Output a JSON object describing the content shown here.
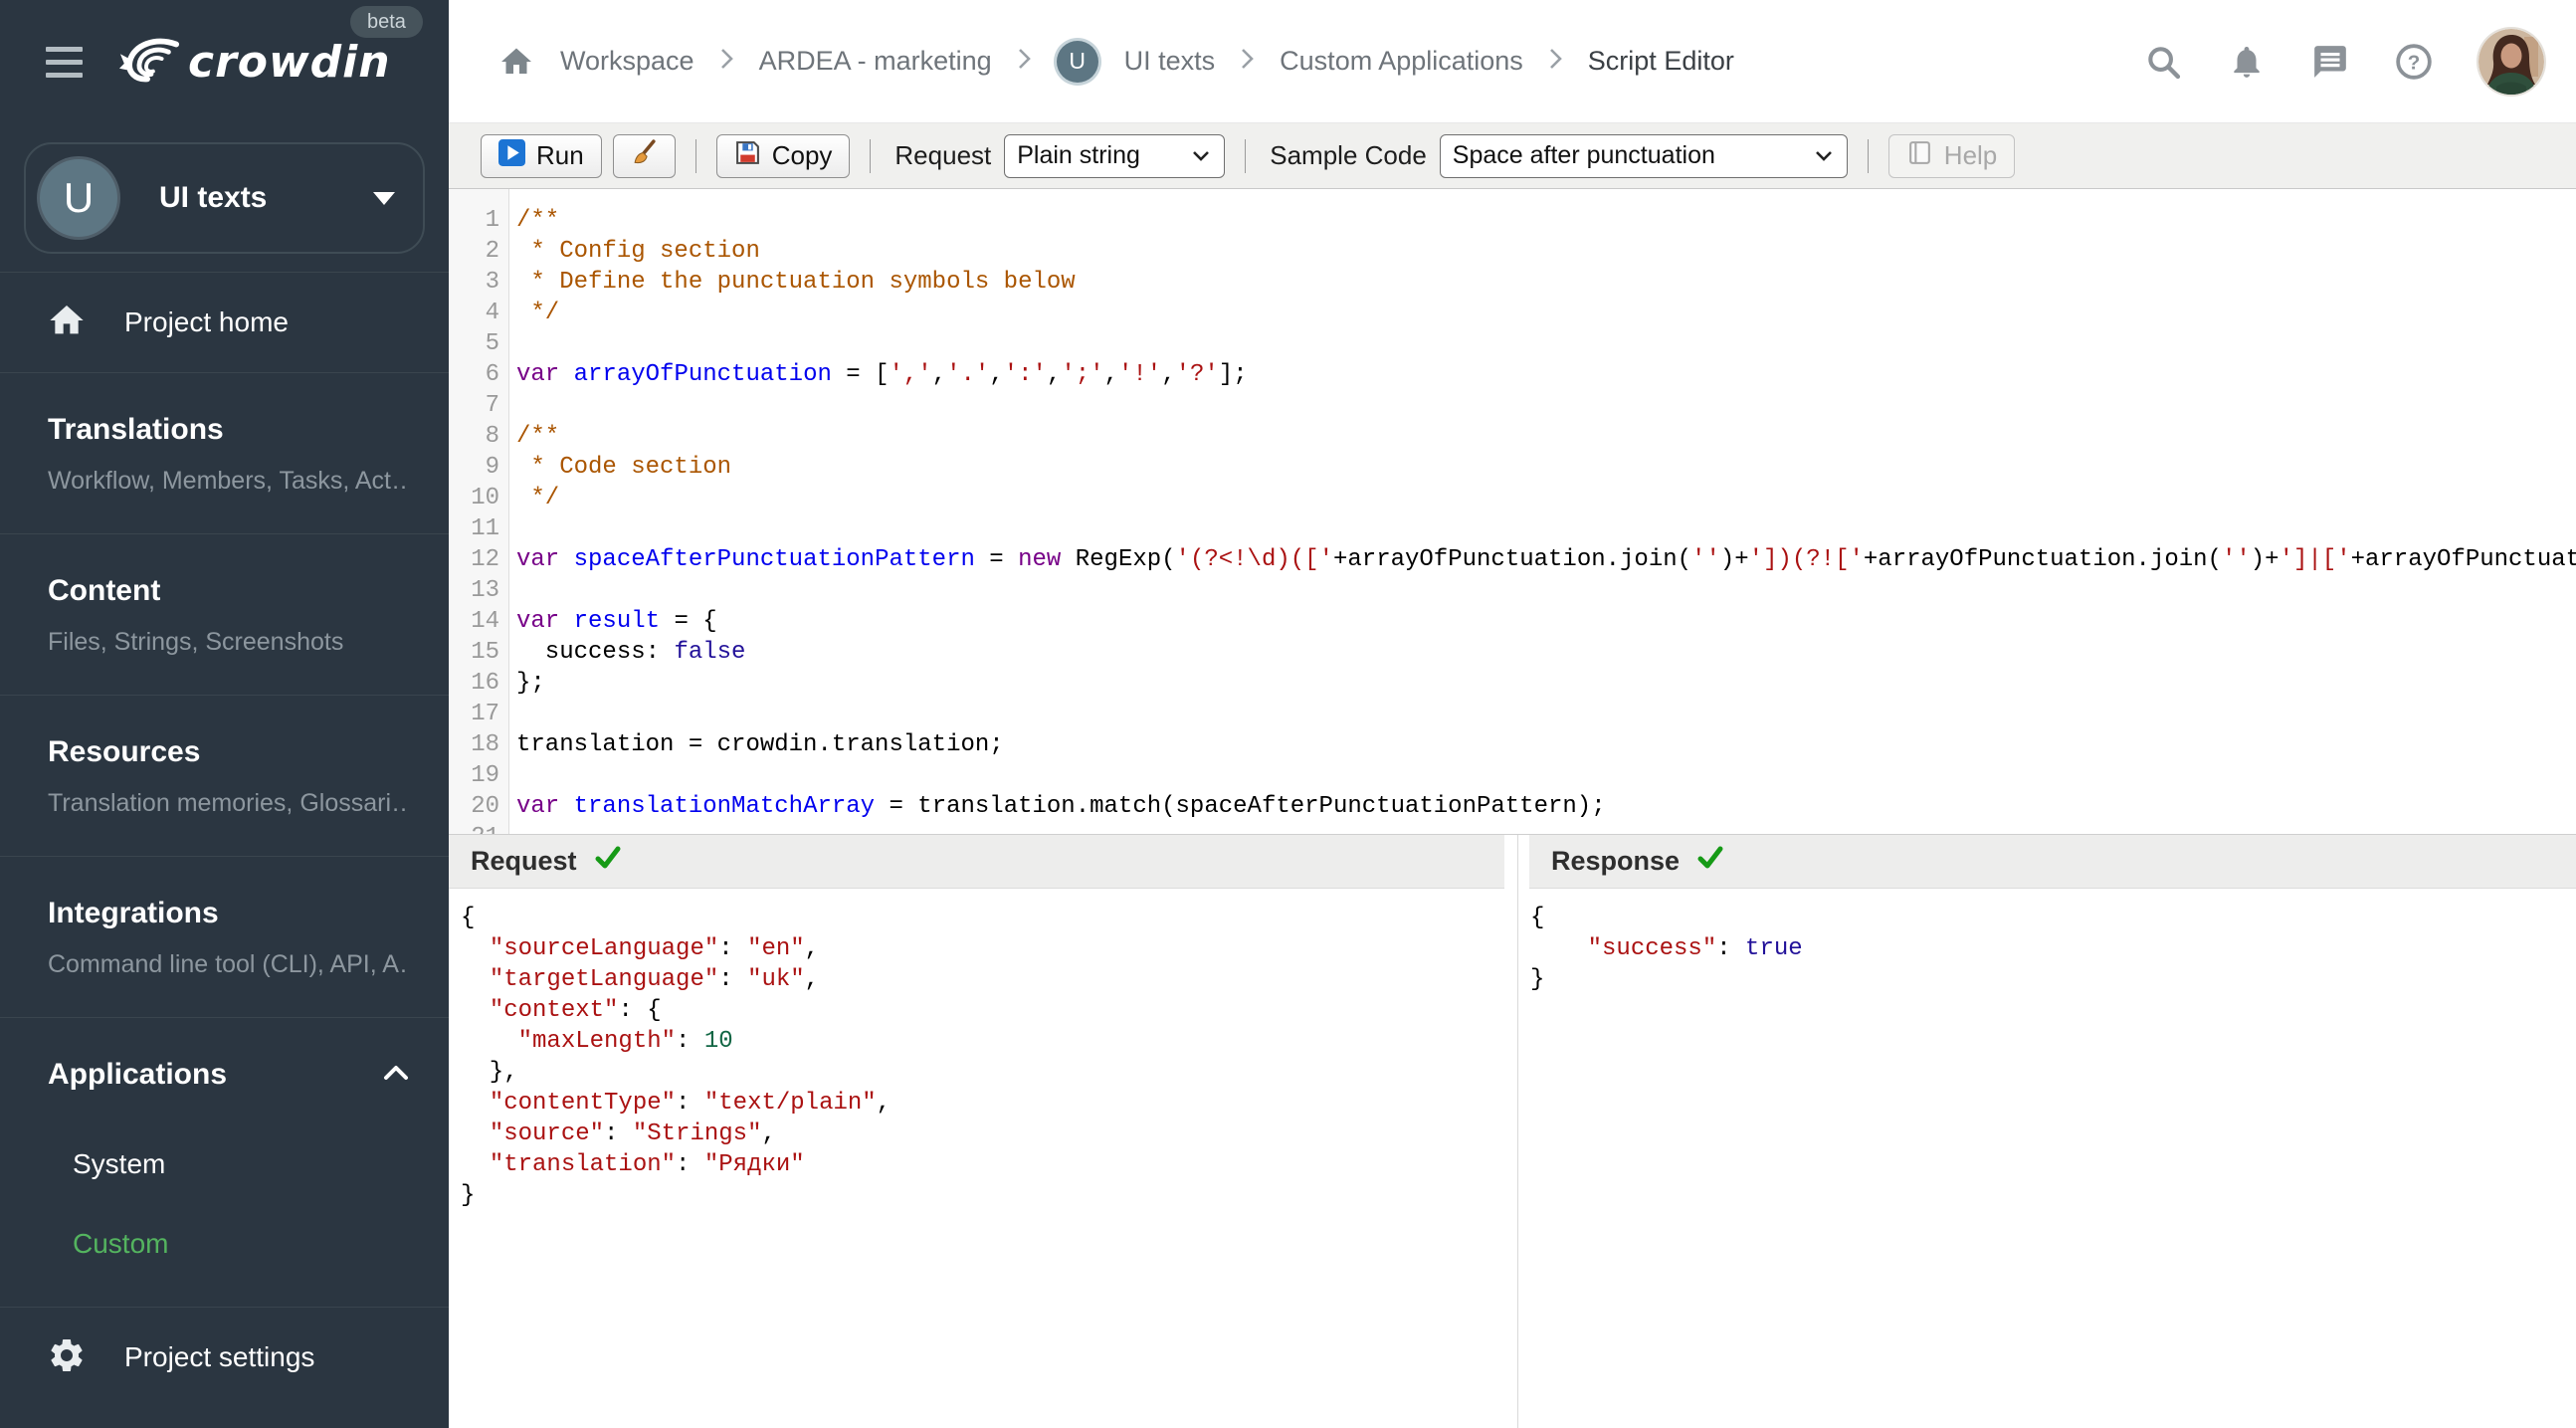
{
  "colors": {
    "sidebar_bg": "#2b3641",
    "active_green": "#54b45f",
    "check_green": "#169a16",
    "run_icon_blue": "#1c74d4"
  },
  "sidebar": {
    "logo_text": "crowdin",
    "beta_badge": "beta",
    "project": {
      "avatar_letter": "U",
      "name": "UI texts"
    },
    "project_home_label": "Project home",
    "sections": [
      {
        "title": "Translations",
        "subtitle": "Workflow, Members, Tasks, Act…"
      },
      {
        "title": "Content",
        "subtitle": "Files, Strings, Screenshots"
      },
      {
        "title": "Resources",
        "subtitle": "Translation memories, Glossari…"
      },
      {
        "title": "Integrations",
        "subtitle": "Command line tool (CLI), API, A…"
      }
    ],
    "applications": {
      "title": "Applications",
      "items": [
        {
          "label": "System"
        },
        {
          "label": "Custom"
        }
      ]
    },
    "project_settings_label": "Project settings"
  },
  "header": {
    "breadcrumb": [
      "Workspace",
      "ARDEA - marketing",
      "UI texts",
      "Custom Applications",
      "Script Editor"
    ],
    "project_avatar_letter": "U"
  },
  "toolbar": {
    "run_label": "Run",
    "copy_label": "Copy",
    "request_label": "Request",
    "request_value": "Plain string",
    "sample_code_label": "Sample Code",
    "sample_code_value": "Space after punctuation",
    "help_label": "Help"
  },
  "editor": {
    "lines": [
      [
        [
          "comment",
          "/**"
        ]
      ],
      [
        [
          "comment",
          " * Config section"
        ]
      ],
      [
        [
          "comment",
          " * Define the punctuation symbols below"
        ]
      ],
      [
        [
          "comment",
          " */"
        ]
      ],
      [],
      [
        [
          "keyword",
          "var"
        ],
        [
          "plain",
          " "
        ],
        [
          "def",
          "arrayOfPunctuation"
        ],
        [
          "plain",
          " = ["
        ],
        [
          "string",
          "','"
        ],
        [
          "plain",
          ","
        ],
        [
          "string",
          "'.'"
        ],
        [
          "plain",
          ","
        ],
        [
          "string",
          "':'"
        ],
        [
          "plain",
          ","
        ],
        [
          "string",
          "';'"
        ],
        [
          "plain",
          ","
        ],
        [
          "string",
          "'!'"
        ],
        [
          "plain",
          ","
        ],
        [
          "string",
          "'?'"
        ],
        [
          "plain",
          "];"
        ]
      ],
      [],
      [
        [
          "comment",
          "/**"
        ]
      ],
      [
        [
          "comment",
          " * Code section"
        ]
      ],
      [
        [
          "comment",
          " */"
        ]
      ],
      [],
      [
        [
          "keyword",
          "var"
        ],
        [
          "plain",
          " "
        ],
        [
          "def",
          "spaceAfterPunctuationPattern"
        ],
        [
          "plain",
          " = "
        ],
        [
          "keyword",
          "new"
        ],
        [
          "plain",
          " RegExp("
        ],
        [
          "string",
          "'(?<!\\d)(['"
        ],
        [
          "plain",
          "+arrayOfPunctuation.join("
        ],
        [
          "string",
          "''"
        ],
        [
          "plain",
          ")+"
        ],
        [
          "string",
          "'])(?!['"
        ],
        [
          "plain",
          "+arrayOfPunctuation.join("
        ],
        [
          "string",
          "''"
        ],
        [
          "plain",
          ")+"
        ],
        [
          "string",
          "']|['"
        ],
        [
          "plain",
          "+arrayOfPunctuati"
        ]
      ],
      [],
      [
        [
          "keyword",
          "var"
        ],
        [
          "plain",
          " "
        ],
        [
          "def",
          "result"
        ],
        [
          "plain",
          " = {"
        ]
      ],
      [
        [
          "plain",
          "  success: "
        ],
        [
          "atom",
          "false"
        ]
      ],
      [
        [
          "plain",
          "};"
        ]
      ],
      [],
      [
        [
          "plain",
          "translation = crowdin.translation;"
        ]
      ],
      [],
      [
        [
          "keyword",
          "var"
        ],
        [
          "plain",
          " "
        ],
        [
          "def",
          "translationMatchArray"
        ],
        [
          "plain",
          " = translation.match(spaceAfterPunctuationPattern);"
        ]
      ],
      []
    ]
  },
  "request_panel": {
    "title": "Request",
    "status_icon": "green-check",
    "lines": [
      [
        [
          "plain",
          "{"
        ]
      ],
      [
        [
          "plain",
          "  "
        ],
        [
          "string",
          "\"sourceLanguage\""
        ],
        [
          "plain",
          ": "
        ],
        [
          "string",
          "\"en\""
        ],
        [
          "plain",
          ","
        ]
      ],
      [
        [
          "plain",
          "  "
        ],
        [
          "string",
          "\"targetLanguage\""
        ],
        [
          "plain",
          ": "
        ],
        [
          "string",
          "\"uk\""
        ],
        [
          "plain",
          ","
        ]
      ],
      [
        [
          "plain",
          "  "
        ],
        [
          "string",
          "\"context\""
        ],
        [
          "plain",
          ": {"
        ]
      ],
      [
        [
          "plain",
          "    "
        ],
        [
          "string",
          "\"maxLength\""
        ],
        [
          "plain",
          ": "
        ],
        [
          "number",
          "10"
        ]
      ],
      [
        [
          "plain",
          "  },"
        ]
      ],
      [
        [
          "plain",
          "  "
        ],
        [
          "string",
          "\"contentType\""
        ],
        [
          "plain",
          ": "
        ],
        [
          "string",
          "\"text/plain\""
        ],
        [
          "plain",
          ","
        ]
      ],
      [
        [
          "plain",
          "  "
        ],
        [
          "string",
          "\"source\""
        ],
        [
          "plain",
          ": "
        ],
        [
          "string",
          "\"Strings\""
        ],
        [
          "plain",
          ","
        ]
      ],
      [
        [
          "plain",
          "  "
        ],
        [
          "string",
          "\"translation\""
        ],
        [
          "plain",
          ": "
        ],
        [
          "string",
          "\"Рядки\""
        ]
      ],
      [
        [
          "plain",
          "}"
        ]
      ]
    ]
  },
  "response_panel": {
    "title": "Response",
    "status_icon": "green-check",
    "lines": [
      [
        [
          "plain",
          "{"
        ]
      ],
      [
        [
          "plain",
          "    "
        ],
        [
          "string",
          "\"success\""
        ],
        [
          "plain",
          ": "
        ],
        [
          "atom",
          "true"
        ]
      ],
      [
        [
          "plain",
          "}"
        ]
      ]
    ]
  }
}
